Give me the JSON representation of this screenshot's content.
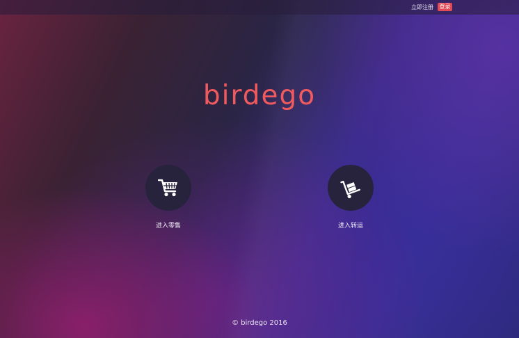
{
  "header": {
    "register_label": "立即注册",
    "login_label": "登录"
  },
  "brand": {
    "logo_text": "birdego",
    "accent_color": "#ee5a5e"
  },
  "entries": [
    {
      "icon": "shopping-cart-icon",
      "label": "进入零售"
    },
    {
      "icon": "hand-truck-icon",
      "label": "进入转运"
    }
  ],
  "footer": {
    "copyright_symbol": "©",
    "text": "birdego 2016"
  }
}
